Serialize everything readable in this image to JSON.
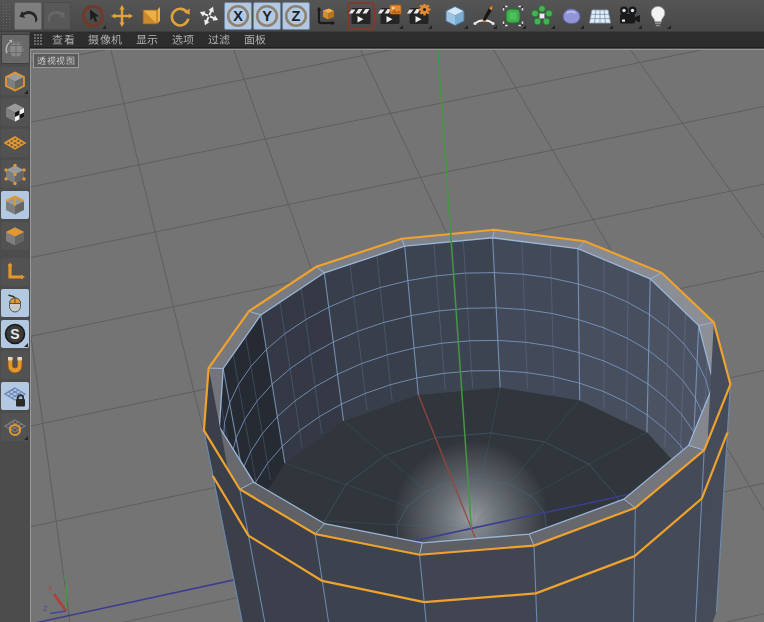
{
  "toolbar": {
    "items": [
      {
        "id": "undo",
        "icon": "undo-icon",
        "enabled": true
      },
      {
        "id": "redo",
        "icon": "redo-icon",
        "enabled": false
      },
      {
        "id": "live-selection",
        "icon": "cursor-selection-icon",
        "has_flyout": true
      },
      {
        "id": "move",
        "icon": "move-tool-icon"
      },
      {
        "id": "scale",
        "icon": "scale-tool-icon"
      },
      {
        "id": "rotate",
        "icon": "rotate-tool-icon"
      },
      {
        "id": "last-tool",
        "icon": "reorder-arrows-icon"
      },
      {
        "id": "lock-x",
        "label": "X",
        "state": "on"
      },
      {
        "id": "lock-y",
        "label": "Y",
        "state": "on"
      },
      {
        "id": "lock-z",
        "label": "Z",
        "state": "on"
      },
      {
        "id": "coord-system",
        "icon": "coordinate-cube-icon"
      },
      {
        "id": "render-view",
        "icon": "clapperboard-icon",
        "state": "highlighted"
      },
      {
        "id": "render-picture-viewer",
        "icon": "clapperboard-picture-icon",
        "has_flyout": true
      },
      {
        "id": "render-settings",
        "icon": "clapperboard-gear-icon",
        "has_flyout": true
      },
      {
        "id": "add-cube",
        "icon": "cube-primitive-icon",
        "has_flyout": true
      },
      {
        "id": "pen-spline",
        "icon": "spline-pen-icon",
        "has_flyout": true
      },
      {
        "id": "subdivision-surface",
        "icon": "green-cage-cube-icon",
        "has_flyout": true
      },
      {
        "id": "modeling-objects",
        "icon": "green-cluster-icon",
        "has_flyout": true
      },
      {
        "id": "volume",
        "icon": "purple-blob-icon",
        "has_flyout": true
      },
      {
        "id": "environment-floor",
        "icon": "floor-grid-icon",
        "has_flyout": true
      },
      {
        "id": "camera",
        "icon": "camera-icon",
        "has_flyout": true
      },
      {
        "id": "light",
        "icon": "light-bulb-icon",
        "has_flyout": true
      }
    ]
  },
  "sidebar": {
    "items": [
      {
        "id": "make-editable",
        "icon": "make-editable-icon",
        "enabled": false
      },
      {
        "id": "model-mode",
        "icon": "model-cube-icon",
        "has_flyout": true
      },
      {
        "id": "texture-mode",
        "icon": "texture-cube-icon"
      },
      {
        "id": "workplane-mode",
        "icon": "workplane-grid-icon"
      },
      {
        "id": "points-mode",
        "icon": "points-cube-icon"
      },
      {
        "id": "edges-mode",
        "icon": "edges-cube-icon",
        "state": "active"
      },
      {
        "id": "polygons-mode",
        "icon": "polygons-cube-icon"
      },
      {
        "id": "enable-axis",
        "icon": "axis-l-icon"
      },
      {
        "id": "viewport-solo",
        "icon": "mouse-icon",
        "state": "active"
      },
      {
        "id": "snap",
        "icon": "snap-s-icon",
        "state": "active",
        "has_flyout": true
      },
      {
        "id": "magnet-snap",
        "icon": "magnet-icon"
      },
      {
        "id": "lock-workplane",
        "icon": "workplane-lock-icon",
        "state": "active"
      },
      {
        "id": "workplane-options",
        "icon": "workplane-ring-icon",
        "has_flyout": true
      }
    ]
  },
  "viewport_menu": {
    "items": [
      {
        "id": "view",
        "label": "查看"
      },
      {
        "id": "cameras",
        "label": "摄像机"
      },
      {
        "id": "display",
        "label": "显示"
      },
      {
        "id": "options",
        "label": "选项"
      },
      {
        "id": "filter",
        "label": "过滤"
      },
      {
        "id": "panel",
        "label": "面板"
      }
    ]
  },
  "viewport": {
    "view_label": "透视视图",
    "axis_gizmo": {
      "x": "X",
      "y": "Y",
      "z": "Z"
    }
  },
  "scene": {
    "object": "cup-cylinder-mesh",
    "selected_edge_loops": 2,
    "mode": "edge-selection"
  },
  "colors": {
    "toolbar_bg": "#4c4c4c",
    "sidebar_bg": "#4c4c4c",
    "menubar_bg": "#2d2d2d",
    "menubar_text": "#b4b4b4",
    "viewport_bg": "#747474",
    "grid_line": "#5e5e5e",
    "selection_orange": "#f0a22e",
    "wireframe_blue": "#7d9cc4",
    "active_tile_blue": "#b3c9e2",
    "axis_x_red": "#a04438",
    "axis_y_green": "#449744",
    "axis_z_blue": "#3d3d8f"
  }
}
